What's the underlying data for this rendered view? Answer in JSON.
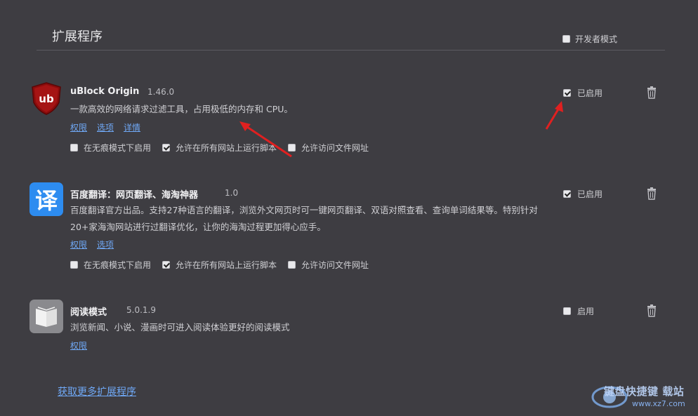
{
  "header": {
    "title": "扩展程序",
    "dev_mode_label": "开发者模式",
    "dev_mode_checked": false
  },
  "extensions": [
    {
      "name": "uBlock Origin",
      "version": "1.46.0",
      "description": "一款高效的网络请求过滤工具，占用极低的内存和 CPU。",
      "links": [
        "权限",
        "选项",
        "详情"
      ],
      "options": [
        {
          "label": "在无痕模式下启用",
          "checked": false
        },
        {
          "label": "允许在所有网站上运行脚本",
          "checked": true
        },
        {
          "label": "允许访问文件网址",
          "checked": false
        }
      ],
      "enabled_label": "已启用",
      "enabled": true,
      "icon": "ublock-shield-icon"
    },
    {
      "name": "百度翻译：网页翻译、海淘神器",
      "version": "1.0",
      "description": "百度翻译官方出品。支持27种语言的翻译，浏览外文网页时可一键网页翻译、双语对照查看、查询单词结果等。特别针对20+家海淘网站进行过翻译优化，让你的海淘过程更加得心应手。",
      "icon_glyph": "译",
      "links": [
        "权限",
        "选项"
      ],
      "options": [
        {
          "label": "在无痕模式下启用",
          "checked": false
        },
        {
          "label": "允许在所有网站上运行脚本",
          "checked": true
        },
        {
          "label": "允许访问文件网址",
          "checked": false
        }
      ],
      "enabled_label": "已启用",
      "enabled": true,
      "icon": "baidu-translate-icon"
    },
    {
      "name": "阅读模式",
      "version": "5.0.1.9",
      "description": "浏览新闻、小说、漫画时可进入阅读体验更好的阅读模式",
      "links": [
        "权限"
      ],
      "options": [],
      "enabled_label": "启用",
      "enabled": false,
      "icon": "book-icon"
    }
  ],
  "footer": {
    "more_link": "获取更多扩展程序"
  },
  "watermark": {
    "text": "键盘快捷键 载站",
    "url": "www.xz7.com"
  },
  "colors": {
    "background": "#3e3d42",
    "link": "#6fa8f5",
    "arrow": "#e02020",
    "ublock_red": "#8b0c0c",
    "baidu_blue": "#2d8cf0"
  }
}
